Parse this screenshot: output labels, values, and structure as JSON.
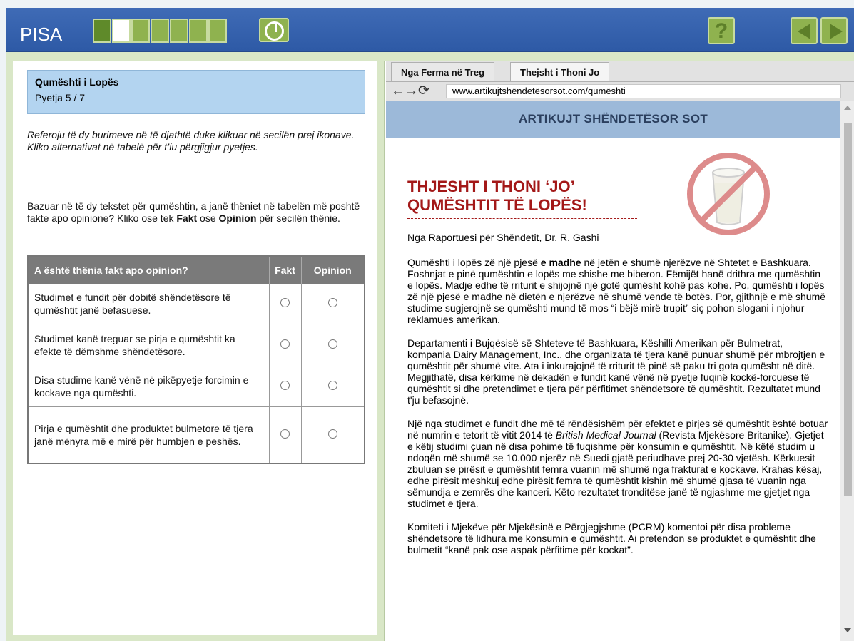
{
  "app": {
    "logo": "PISA",
    "progress": {
      "total": 7,
      "completed": 1,
      "current": 2
    },
    "help_label": "?"
  },
  "left": {
    "unit_title": "Qumështi i Lopës",
    "question_number": "Pyetja 5 / 7",
    "instructions": "Referoju të dy burimeve në të djathtë duke klikuar në secilën prej ikonave. Kliko alternativat në tabelë për t’iu përgjigjur pyetjes.",
    "question_start": "Bazuar në të dy tekstet për qumështin, a janë thëniet në tabelën më poshtë fakte apo opinione? Kliko ose tek ",
    "question_fact": "Fakt",
    "question_or": " ose ",
    "question_opinion": "Opinion",
    "question_end": " për secilën thënie.",
    "table": {
      "header": "A është thënia fakt apo opinion?",
      "col_fact": "Fakt",
      "col_opinion": "Opinion",
      "rows": [
        "Studimet e fundit për dobitë shëndetësore të qumështit janë befasuese.",
        "Studimet kanë treguar se pirja e qumështit ka efekte të dëmshme shëndetësore.",
        "Disa studime kanë vënë në pikëpyetje forcimin e kockave nga qumështi.",
        "Pirja e qumështit dhe produktet bulmetore të tjera janë mënyra më e mirë për humbjen e peshës."
      ]
    }
  },
  "browser": {
    "tabs": [
      "Nga Ferma në Treg",
      "Thejsht i Thoni Jo"
    ],
    "active_tab": 1,
    "nav_arrows": "←→⟳",
    "url": "www.artikujtshëndetësorsot.com/qumështi"
  },
  "article": {
    "site_name": "ARTIKUJT SHËNDETËSOR SOT",
    "title_line1": "THJESHT I THONI ‘JO’",
    "title_line2": "QUMËSHTIT TË LOPËS!",
    "byline": "Nga Raportuesi për Shëndetit, Dr. R. Gashi",
    "p1_a": "Qumështi i lopës zë një pjesë ",
    "p1_bold": "e madhe",
    "p1_b": " në jetën e shumë njerëzve në Shtetet e Bashkuara. Foshnjat e pinë qumështin e lopës me shishe me biberon. Fëmijët hanë drithra me qumështin e lopës. Madje edhe të rriturit e shijojnë një gotë qumësht kohë pas kohe. Po, qumështi i lopës zë një pjesë e madhe në dietën e njerëzve në shumë vende të botës. Por, gjithnjë e më shumë studime sugjerojnë se qumështi mund të mos “i bëjë mirë trupit” siç pohon slogani i njohur reklamues amerikan.",
    "p2": "Departamenti i Bujqësisë së Shteteve të Bashkuara, Këshilli Amerikan për Bulmetrat, kompania Dairy Management, Inc., dhe organizata të tjera kanë punuar shumë për mbrojtjen e qumështit për shumë vite. Ata i inkurajojnë të rriturit të pinë së paku tri gota qumësht në ditë. Megjithatë, disa kërkime në dekadën e fundit kanë vënë në pyetje fuqinë kockë-forcuese të qumështit si dhe pretendimet e tjera për përfitimet shëndetsore të qumështit. Rezultatet mund t'ju befasojnë.",
    "p3_a": "Një nga studimet e fundit dhe më të rëndësishëm për efektet e pirjes së qumështit është botuar në numrin e tetorit të vitit 2014 të ",
    "p3_italic": "British Medical Journal",
    "p3_b": " (Revista Mjekësore Britanike). Gjetjet e këtij studimi çuan në disa pohime të fuqishme për konsumin e qumështit. Në këtë studim u ndoqën më shumë se 10.000 njerëz në Suedi gjatë periudhave prej 20-30 vjetësh. Kërkuesit zbuluan se pirësit e qumështit femra vuanin më shumë nga frakturat e kockave. Krahas kësaj, edhe pirësit meshkuj edhe pirësit femra të qumështit kishin më shumë gjasa të vuanin nga sëmundja e zemrës dhe kanceri. Këto rezultatet tronditëse janë të ngjashme me gjetjet nga studimet e tjera.",
    "p4": "Komiteti i Mjekëve për Mjekësinë e Përgjegjshme (PCRM) komentoi për disa probleme shëndetsore të lidhura me konsumin e qumështit. Ai pretendon se produktet e qumështit dhe bulmetit “kanë pak ose aspak përfitime për kockat”."
  },
  "colors": {
    "topbar": "#3264b0",
    "accent_green": "#8fb24f",
    "title_red": "#a31818",
    "banner_blue": "#9cb9d9"
  }
}
